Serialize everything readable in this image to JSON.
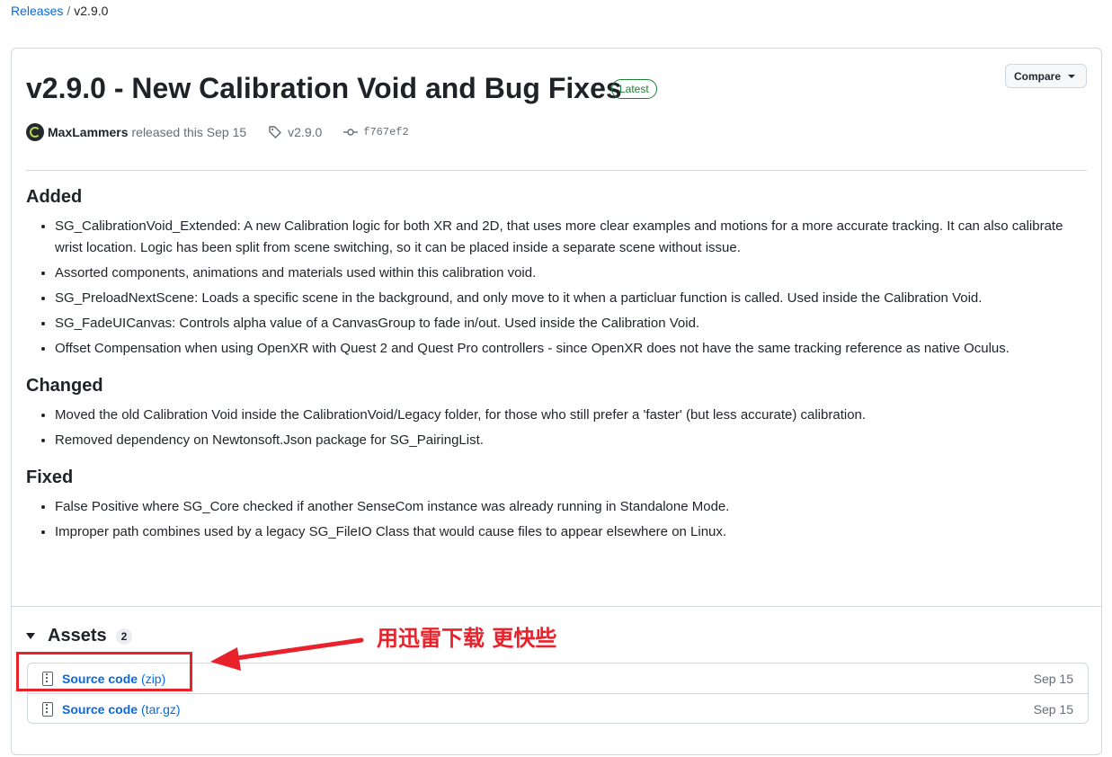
{
  "breadcrumb": {
    "parent": "Releases",
    "separator": "/",
    "current": "v2.9.0"
  },
  "release": {
    "title": "v2.9.0 - New Calibration Void and Bug Fixes",
    "badge": "Latest",
    "compare_label": "Compare",
    "author": "MaxLammers",
    "released_text": "released this Sep 15",
    "tag": "v2.9.0",
    "commit": "f767ef2"
  },
  "notes": {
    "added_heading": "Added",
    "added": [
      "SG_CalibrationVoid_Extended: A new Calibration logic for both XR and 2D, that uses more clear examples and motions for a more accurate tracking. It can also calibrate wrist location. Logic has been split from scene switching, so it can be placed inside a separate scene without issue.",
      "Assorted components, animations and materials used within this calibration void.",
      "SG_PreloadNextScene: Loads a specific scene in the background, and only move to it when a particluar function is called. Used inside the Calibration Void.",
      "SG_FadeUICanvas: Controls alpha value of a CanvasGroup to fade in/out. Used inside the Calibration Void.",
      "Offset Compensation when using OpenXR with Quest 2 and Quest Pro controllers - since OpenXR does not have the same tracking reference as native Oculus."
    ],
    "changed_heading": "Changed",
    "changed": [
      "Moved the old Calibration Void inside the CalibrationVoid/Legacy folder, for those who still prefer a 'faster' (but less accurate) calibration.",
      "Removed dependency on Newtonsoft.Json package for SG_PairingList."
    ],
    "fixed_heading": "Fixed",
    "fixed": [
      "False Positive where SG_Core checked if another SenseCom instance was already running in Standalone Mode.",
      "Improper path combines used by a legacy SG_FileIO Class that would cause files to appear elsewhere on Linux."
    ]
  },
  "assets": {
    "title": "Assets",
    "count": "2",
    "items": [
      {
        "name": "Source code",
        "ext": "(zip)",
        "date": "Sep 15"
      },
      {
        "name": "Source code",
        "ext": "(tar.gz)",
        "date": "Sep 15"
      }
    ]
  },
  "annotation": {
    "text": "用迅雷下载 更快些",
    "color": "#e8212b"
  },
  "colors": {
    "link": "#0969da",
    "latest": "#1a7f37",
    "annotation": "#e8212b"
  }
}
